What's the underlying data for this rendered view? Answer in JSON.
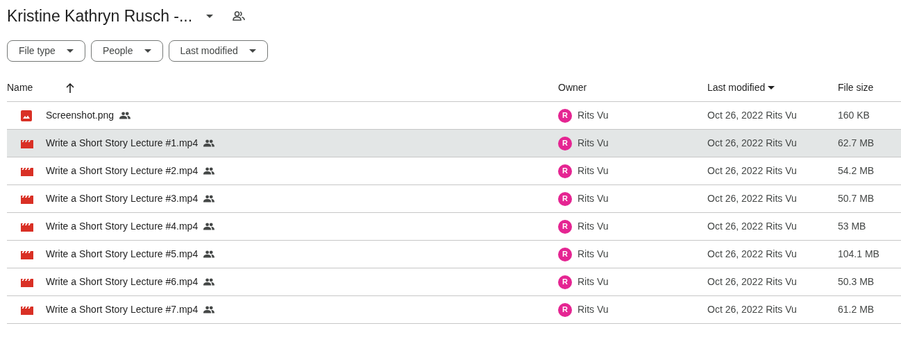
{
  "title": "Kristine Kathryn Rusch -...",
  "filters": [
    "File type",
    "People",
    "Last modified"
  ],
  "columns": [
    {
      "label": "Name",
      "sort_up": true,
      "sort_down": false
    },
    {
      "label": "Owner",
      "sort_up": false,
      "sort_down": false
    },
    {
      "label": "Last modified",
      "sort_up": false,
      "sort_down": true
    },
    {
      "label": "File size",
      "sort_up": false,
      "sort_down": false
    }
  ],
  "rows": [
    {
      "kind": "image",
      "name": "Screenshot.png",
      "shared": true,
      "highlighted": false,
      "avatar": "R",
      "owner": "Rits Vu",
      "modified": "Oct 26, 2022",
      "modified_by": "Rits Vu",
      "size": "160 KB"
    },
    {
      "kind": "video",
      "name": "Write a Short Story Lecture #1.mp4",
      "shared": true,
      "highlighted": true,
      "avatar": "R",
      "owner": "Rits Vu",
      "modified": "Oct 26, 2022",
      "modified_by": "Rits Vu",
      "size": "62.7 MB"
    },
    {
      "kind": "video",
      "name": "Write a Short Story Lecture #2.mp4",
      "shared": true,
      "highlighted": false,
      "avatar": "R",
      "owner": "Rits Vu",
      "modified": "Oct 26, 2022",
      "modified_by": "Rits Vu",
      "size": "54.2 MB"
    },
    {
      "kind": "video",
      "name": "Write a Short Story Lecture #3.mp4",
      "shared": true,
      "highlighted": false,
      "avatar": "R",
      "owner": "Rits Vu",
      "modified": "Oct 26, 2022",
      "modified_by": "Rits Vu",
      "size": "50.7 MB"
    },
    {
      "kind": "video",
      "name": "Write a Short Story Lecture #4.mp4",
      "shared": true,
      "highlighted": false,
      "avatar": "R",
      "owner": "Rits Vu",
      "modified": "Oct 26, 2022",
      "modified_by": "Rits Vu",
      "size": "53 MB"
    },
    {
      "kind": "video",
      "name": "Write a Short Story Lecture #5.mp4",
      "shared": true,
      "highlighted": false,
      "avatar": "R",
      "owner": "Rits Vu",
      "modified": "Oct 26, 2022",
      "modified_by": "Rits Vu",
      "size": "104.1 MB"
    },
    {
      "kind": "video",
      "name": "Write a Short Story Lecture #6.mp4",
      "shared": true,
      "highlighted": false,
      "avatar": "R",
      "owner": "Rits Vu",
      "modified": "Oct 26, 2022",
      "modified_by": "Rits Vu",
      "size": "50.3 MB"
    },
    {
      "kind": "video",
      "name": "Write a Short Story Lecture #7.mp4",
      "shared": true,
      "highlighted": false,
      "avatar": "R",
      "owner": "Rits Vu",
      "modified": "Oct 26, 2022",
      "modified_by": "Rits Vu",
      "size": "61.2 MB"
    }
  ]
}
